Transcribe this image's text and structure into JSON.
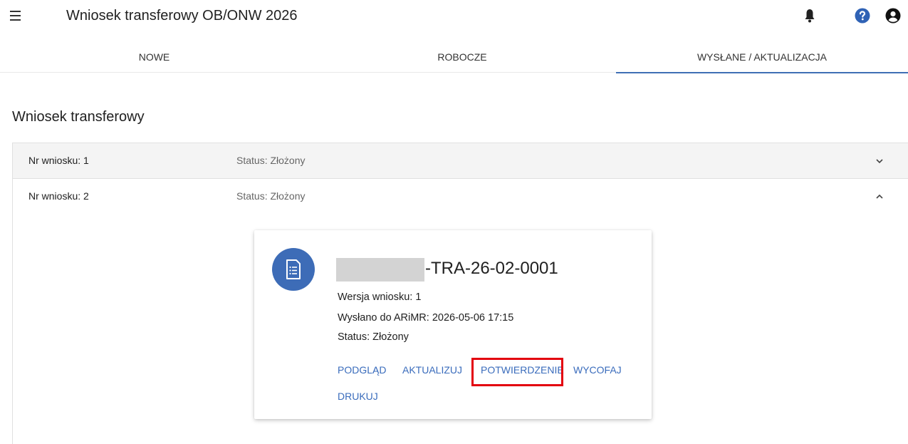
{
  "header": {
    "title": "Wniosek transferowy OB/ONW 2026",
    "icons": [
      "menu-icon",
      "bell-icon",
      "help-icon",
      "account-icon"
    ]
  },
  "tabs": [
    {
      "label": "NOWE"
    },
    {
      "label": "ROBOCZE"
    },
    {
      "label": "WYSŁANE / AKTUALIZACJA",
      "active": true
    }
  ],
  "section": {
    "title": "Wniosek transferowy"
  },
  "applications": [
    {
      "number": "Nr wniosku: 1",
      "status": "Status: Złożony",
      "expanded": false
    },
    {
      "number": "Nr wniosku: 2",
      "status": "Status: Złożony",
      "expanded": true
    }
  ],
  "card": {
    "doc_id_suffix": "-TRA-26-02-0001",
    "version": "Wersja wniosku: 1",
    "sent": "Wysłano do ARiMR: 2026-05-06 17:15",
    "status": "Status: Złożony",
    "actions": [
      "PODGLĄD",
      "AKTUALIZUJ",
      "POTWIERDZENIE",
      "WYCOFAJ",
      "DRUKUJ"
    ],
    "highlighted_action": "POTWIERDZENIE"
  },
  "colors": {
    "accent": "#3f6fb5",
    "avatar": "#3d6cb7",
    "highlight": "#e3000f",
    "link": "#3a6cbc"
  }
}
